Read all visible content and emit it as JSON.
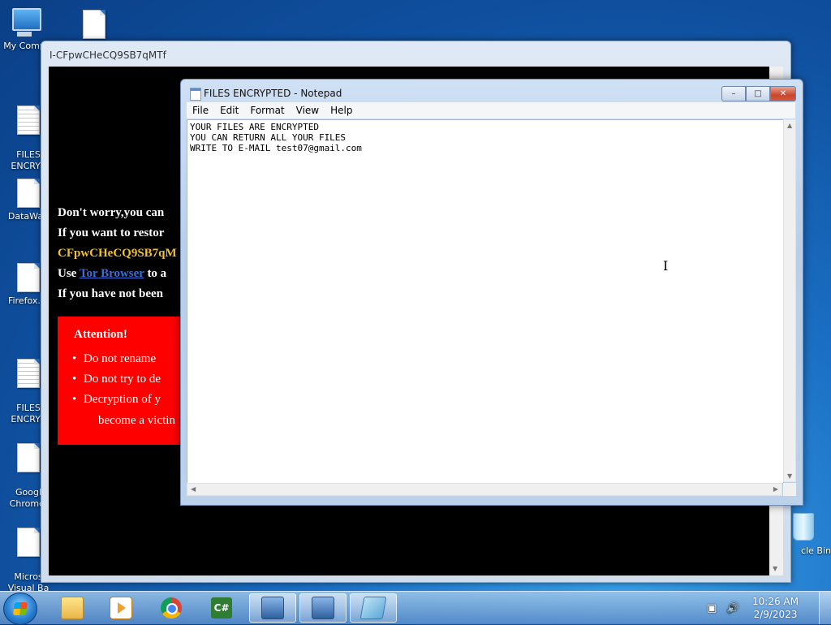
{
  "desktop": {
    "icons": [
      {
        "label": "My Comp",
        "icon": "computer-icon"
      },
      {
        "label": "FILES\nENCRYP",
        "icon": "text-file-icon"
      },
      {
        "label": "DataWag",
        "icon": "file-icon"
      },
      {
        "label": "Firefox.In",
        "icon": "file-icon"
      },
      {
        "label": "FILES\nENCRYP",
        "icon": "text-file-icon"
      },
      {
        "label": "Googl\nChrome.",
        "icon": "file-icon"
      },
      {
        "label": "Micros\nVisual Ba",
        "icon": "file-icon"
      },
      {
        "label": "",
        "icon": "file-icon"
      },
      {
        "label": "cle Bin",
        "icon": "recycle-bin-icon"
      }
    ]
  },
  "ransom_window": {
    "title": "I-CFpwCHeCQ9SB7qMTf",
    "lines": [
      "Don't worry,you can",
      "If you want to restor",
      "CFpwCHeCQ9SB7qM",
      "Use ",
      "If you have not been"
    ],
    "tor_link": "Tor Browser",
    "tor_suffix": " to a",
    "attention": {
      "heading": "Attention!",
      "items": [
        "Do not rename",
        "Do not try to de",
        "Decryption of y"
      ],
      "continuation": "become a victin"
    }
  },
  "notepad": {
    "title": "FILES ENCRYPTED - Notepad",
    "menu": [
      "File",
      "Edit",
      "Format",
      "View",
      "Help"
    ],
    "content": "YOUR FILES ARE ENCRYPTED\nYOU CAN RETURN ALL YOUR FILES\nWRITE TO E-MAIL test07@gmail.com",
    "buttons": {
      "minimize": "–",
      "maximize": "□",
      "close": "✕"
    }
  },
  "taskbar": {
    "items": [
      {
        "icon": "folder-icon",
        "active": false
      },
      {
        "icon": "media-player-icon",
        "active": false
      },
      {
        "icon": "chrome-icon",
        "active": false
      },
      {
        "icon": "csharp-icon",
        "label": "C#",
        "active": false
      },
      {
        "icon": "setup-icon",
        "active": false
      },
      {
        "icon": "setup-icon",
        "active": false
      },
      {
        "icon": "notepad-icon",
        "active": true
      }
    ],
    "clock": {
      "time": "10:26 AM",
      "date": "2/9/2023"
    }
  }
}
